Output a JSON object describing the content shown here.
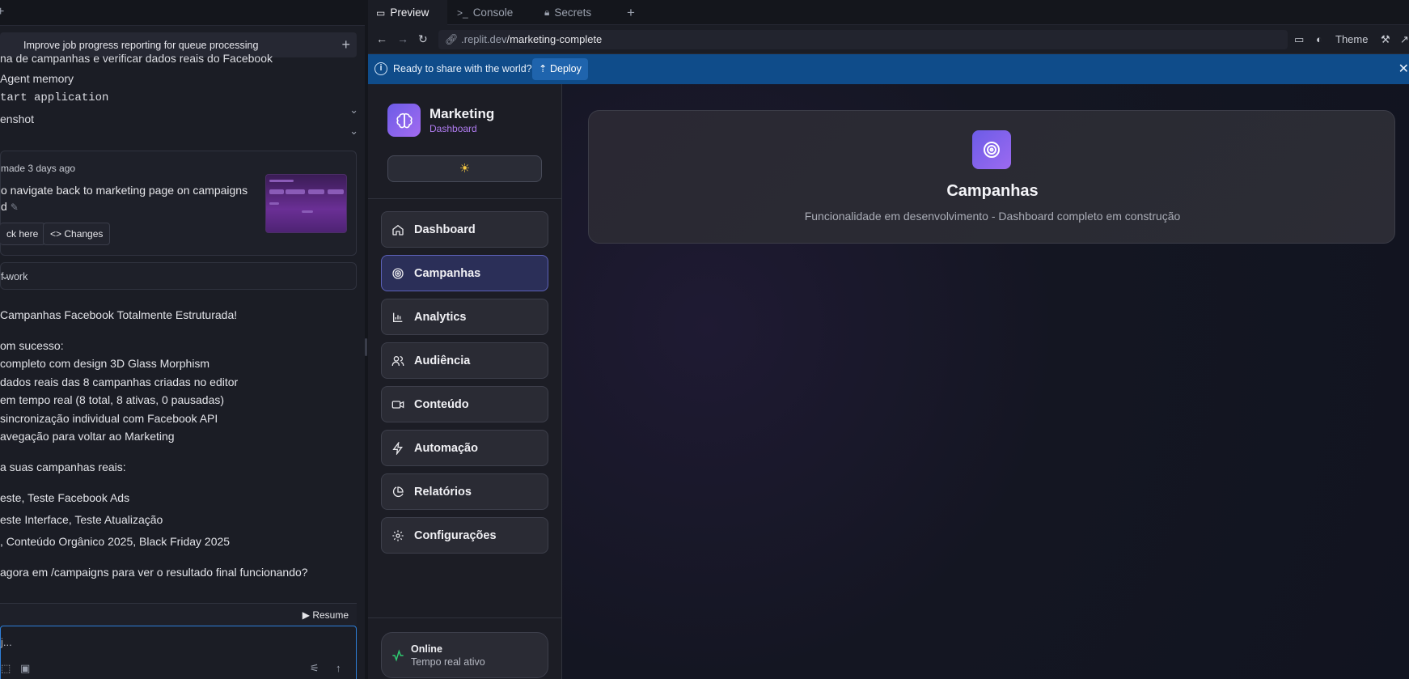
{
  "left_panel": {
    "thread_title": "Improve job progress reporting for queue processing",
    "rows": [
      "na de campanhas e verificar dados reais do Facebook",
      "Agent memory",
      "tart application",
      "enshot"
    ],
    "checkpoint": {
      "meta": "made 3 days ago",
      "message_line1": "o navigate back to marketing page on campaigns",
      "message_line2": "d",
      "rollback_label": "ck here",
      "changes_label": "Changes"
    },
    "work_label": "f work",
    "body_lines": [
      "Campanhas Facebook Totalmente Estruturada!",
      "om sucesso:",
      "completo com design 3D Glass Morphism",
      "dados reais das 8 campanhas criadas no editor",
      "em tempo real (8 total, 8 ativas, 0 pausadas)",
      "sincronização individual com Facebook API",
      "avegação para voltar ao Marketing",
      "a suas campanhas reais:",
      "este, Teste Facebook Ads",
      "este Interface, Teste Atualização",
      ", Conteúdo Orgânico 2025, Black Friday 2025",
      "agora em /campaigns para ver o resultado final funcionando?"
    ],
    "resume_label": "Resume",
    "input_placeholder": "j..."
  },
  "tabs": [
    {
      "label": "Preview",
      "icon": "monitor-icon"
    },
    {
      "label": "Console",
      "icon": "terminal-icon"
    },
    {
      "label": "Secrets",
      "icon": "lock-icon"
    }
  ],
  "address": {
    "url_prefix": ".replit.dev",
    "url_path": "/marketing-complete",
    "theme_label": "Theme"
  },
  "banner": {
    "text": "Ready to share with the world?",
    "deploy_label": "Deploy"
  },
  "app": {
    "brand_title": "Marketing",
    "brand_subtitle": "Dashboard",
    "nav": [
      {
        "label": "Dashboard",
        "icon": "home-icon"
      },
      {
        "label": "Campanhas",
        "icon": "target-icon",
        "active": true
      },
      {
        "label": "Analytics",
        "icon": "bar-chart-icon"
      },
      {
        "label": "Audiência",
        "icon": "users-icon"
      },
      {
        "label": "Conteúdo",
        "icon": "video-icon"
      },
      {
        "label": "Automação",
        "icon": "bolt-icon"
      },
      {
        "label": "Relatórios",
        "icon": "pie-chart-icon"
      },
      {
        "label": "Configurações",
        "icon": "gear-icon"
      }
    ],
    "status_title": "Online",
    "status_subtitle": "Tempo real ativo",
    "main_title": "Campanhas",
    "main_subtitle": "Funcionalidade em desenvolvimento - Dashboard completo em construção",
    "colors": {
      "accent": "#6c5ce7",
      "brand_subtitle": "#b07cf0",
      "banner": "#0f4c8a",
      "online": "#2ecc71"
    }
  }
}
